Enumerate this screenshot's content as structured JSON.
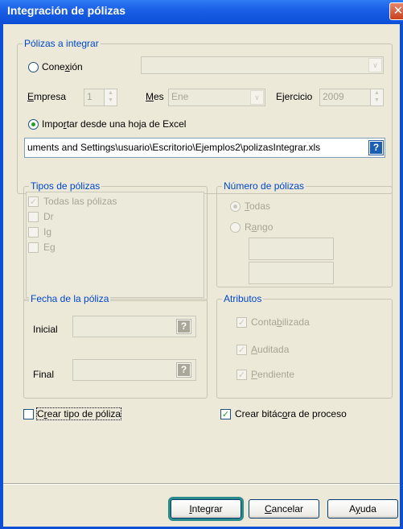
{
  "window": {
    "title": "Integración de pólizas"
  },
  "polizas_integrar": {
    "legend": "Pólizas a integrar",
    "conexion": {
      "label_pre": "Cone",
      "label_u": "x",
      "label_post": "ión",
      "selected": false
    },
    "empresa": {
      "label_u": "E",
      "label_post": "mpresa",
      "value": "1"
    },
    "mes": {
      "label_u": "M",
      "label_post": "es",
      "value": "Ene"
    },
    "ejercicio": {
      "label": "Ejercicio",
      "value": "2009"
    },
    "importar": {
      "label_pre": "Impo",
      "label_u": "r",
      "label_post": "tar desde una hoja de Excel",
      "selected": true
    },
    "path": "uments and Settings\\usuario\\Escritorio\\Ejemplos2\\polizasIntegrar.xls",
    "help_glyph": "?"
  },
  "tipos_polizas": {
    "legend": "Tipos de pólizas",
    "items": [
      {
        "label": "Todas las pólizas",
        "checked": true
      },
      {
        "label": "Dr",
        "checked": false
      },
      {
        "label": "Ig",
        "checked": false
      },
      {
        "label": "Eg",
        "checked": false
      }
    ]
  },
  "numero_polizas": {
    "legend": "Número de pólizas",
    "todas": {
      "label_u": "T",
      "label_post": "odas"
    },
    "rango": {
      "label_pre": "R",
      "label_u": "a",
      "label_post": "ngo"
    }
  },
  "fecha_poliza": {
    "legend": "Fecha de la póliza",
    "inicial": "Inicial",
    "final": "Final",
    "help_glyph": "?"
  },
  "atributos": {
    "legend": "Atributos",
    "contabilizada": {
      "label_pre": "Conta",
      "label_u": "b",
      "label_post": "ilizada"
    },
    "auditada": {
      "label_u": "A",
      "label_post": "uditada"
    },
    "pendiente": {
      "label_u": "P",
      "label_post": "endiente"
    }
  },
  "crear_tipo": {
    "label_pre": "C",
    "label_u": "r",
    "label_post": "ear tipo de póliza",
    "checked": false
  },
  "crear_bitacora": {
    "label_pre": "Crear bitác",
    "label_u": "o",
    "label_post": "ra de proceso",
    "checked": true
  },
  "buttons": {
    "integrar": {
      "label_u": "I",
      "label_post": "ntegrar"
    },
    "cancelar": {
      "label_u": "C",
      "label_post": "ancelar"
    },
    "ayuda": {
      "label_pre": "A",
      "label_u": "y",
      "label_post": "uda"
    }
  },
  "glyphs": {
    "check": "✓",
    "close": "✕",
    "arrow_down": "∨",
    "up": "▲",
    "down": "▼"
  },
  "colors": {
    "legend": "#0046d5",
    "title_bar": "#0a4fd6",
    "check_green": "#21a121",
    "dialog_bg": "#ece9d8"
  }
}
